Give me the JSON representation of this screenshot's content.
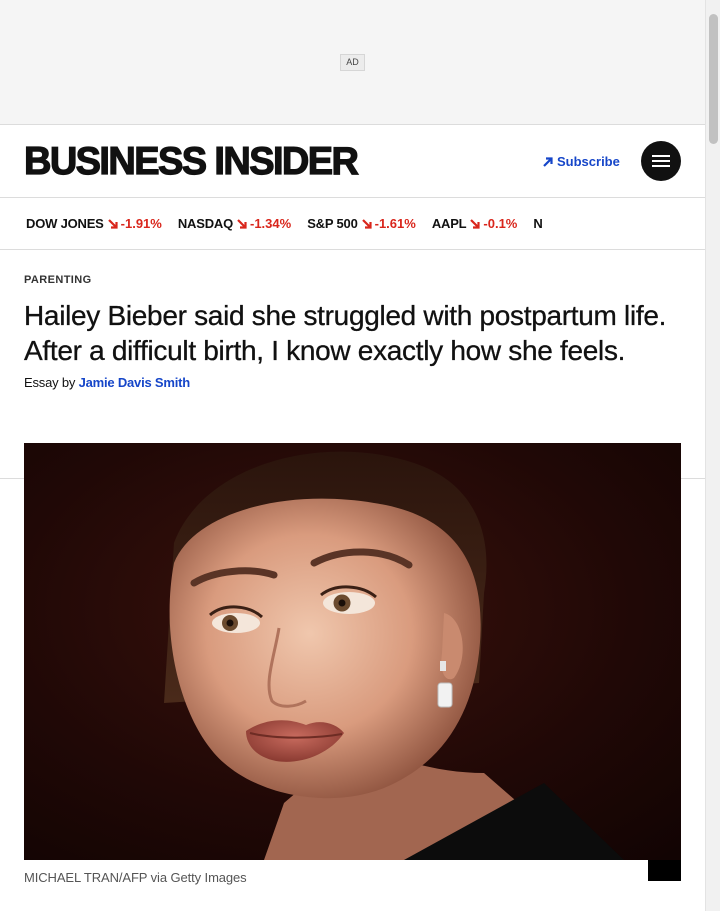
{
  "ad": {
    "label": "AD"
  },
  "header": {
    "logo": "BUSINESS INSIDER",
    "subscribe_label": "Subscribe",
    "menu_icon": "hamburger-menu-icon"
  },
  "ticker": [
    {
      "symbol": "DOW JONES",
      "change": "-1.91%"
    },
    {
      "symbol": "NASDAQ",
      "change": "-1.34%"
    },
    {
      "symbol": "S&P 500",
      "change": "-1.61%"
    },
    {
      "symbol": "AAPL",
      "change": "-0.1%"
    },
    {
      "symbol": "N",
      "change": ""
    }
  ],
  "article": {
    "category": "PARENTING",
    "headline": "Hailey Bieber said she struggled with postpartum life. After a difficult birth, I know exactly how she feels.",
    "byline_prefix": "Essay by ",
    "author": "Jamie Davis Smith",
    "image_credit": "MICHAEL TRAN/AFP via Getty Images"
  },
  "colors": {
    "accent_blue": "#1646c9",
    "negative_red": "#d9261c",
    "text": "#111111"
  }
}
